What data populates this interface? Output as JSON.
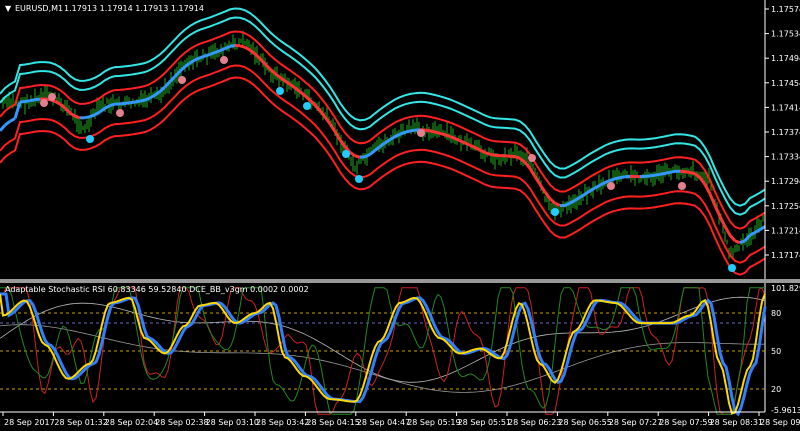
{
  "header": {
    "symbol": "EURUSD,M1",
    "prices": "1.17913 1.17914 1.17913 1.17914"
  },
  "main_axis": {
    "labels": [
      "1.17574",
      "1.17534",
      "1.17494",
      "1.17454",
      "1.17414",
      "1.17374",
      "1.17334",
      "1.17294",
      "1.17254",
      "1.17214",
      "1.17174"
    ]
  },
  "indicator": {
    "title": "Adaptable Stochastic RSI 60.83346 59.52840  DCE_BB_v3gm 0.0002 0.0002",
    "axis_labels": [
      "101.8292",
      "80",
      "50",
      "20",
      "-5.96137"
    ],
    "levels": [
      80,
      50,
      20
    ]
  },
  "time_axis": {
    "labels": [
      "28 Sep 2017",
      "28 Sep 01:32",
      "28 Sep 02:04",
      "28 Sep 02:38",
      "28 Sep 03:10",
      "28 Sep 03:42",
      "28 Sep 04:15",
      "28 Sep 04:47",
      "28 Sep 05:19",
      "28 Sep 05:51",
      "28 Sep 06:23",
      "28 Sep 06:55",
      "28 Sep 07:27",
      "28 Sep 07:59",
      "28 Sep 08:31",
      "28 Sep 09:03"
    ]
  },
  "colors": {
    "background": "#000000",
    "grid_text": "#ffffff",
    "candles": "#22aa22",
    "outer_band": "#33e6e6",
    "inner_band": "#ff2020",
    "mid_up": "#3399ff",
    "mid_down": "#ff3333",
    "dot_sell": "#e57f8f",
    "dot_buy": "#22ccff",
    "stoch_main": "#ffd800",
    "stoch_signal": "#2f7fff",
    "stoch_red": "#cc2222",
    "stoch_green": "#228822",
    "level_line": "#c8a000"
  }
}
